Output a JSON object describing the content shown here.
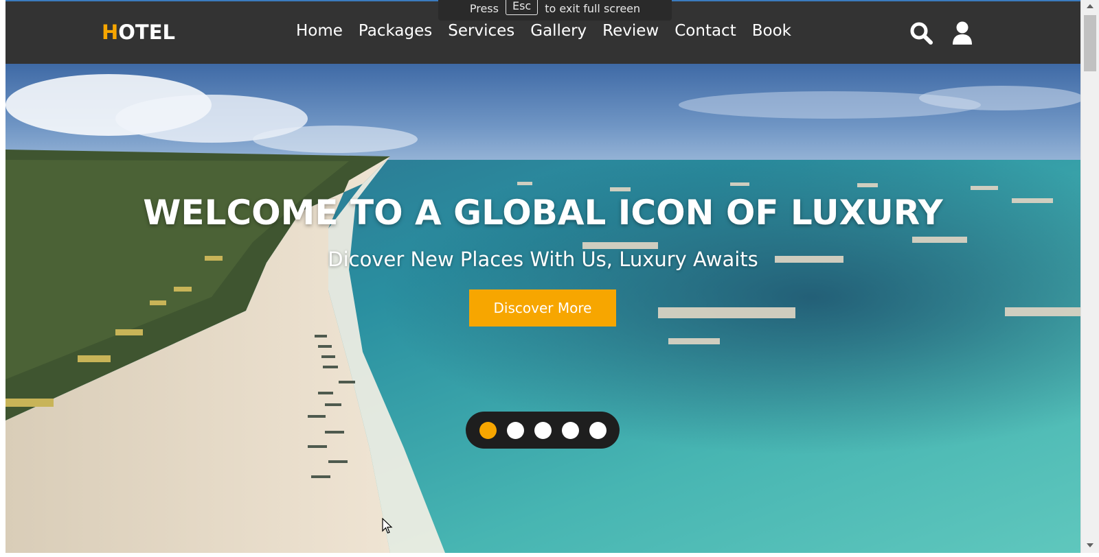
{
  "fullscreen_notice": {
    "before": "Press",
    "key": "Esc",
    "after": "to exit full screen"
  },
  "brand": {
    "first_letter": "H",
    "rest": "OTEL",
    "accent_color": "#f7a600"
  },
  "nav": {
    "links": [
      "Home",
      "Packages",
      "Services",
      "Gallery",
      "Review",
      "Contact",
      "Book"
    ],
    "icons": [
      "search-icon",
      "user-icon"
    ]
  },
  "hero": {
    "title": "WELCOME TO A GLOBAL ICON OF LUXURY",
    "subtitle": "Dicover New Places With Us, Luxury Awaits",
    "cta_label": "Discover More"
  },
  "slider": {
    "total": 5,
    "active_index": 0
  },
  "colors": {
    "navbar": "#333333",
    "accent": "#f7a600",
    "dots_bg": "#1e1e1e"
  }
}
